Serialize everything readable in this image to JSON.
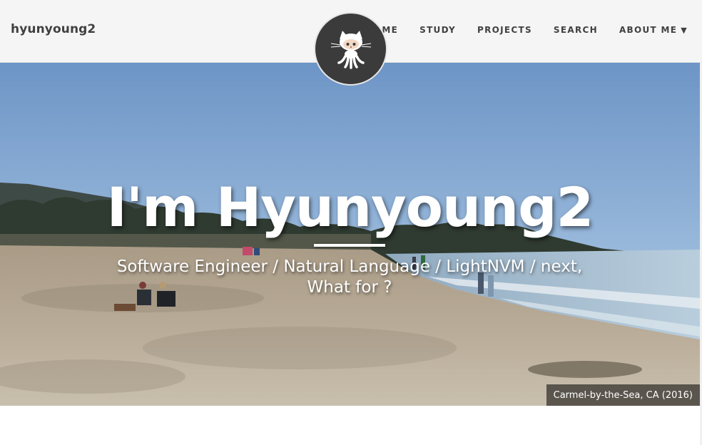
{
  "navbar": {
    "brand": "hyunyoung2",
    "items": [
      {
        "label": "HOME"
      },
      {
        "label": "STUDY"
      },
      {
        "label": "PROJECTS"
      },
      {
        "label": "SEARCH"
      },
      {
        "label": "ABOUT ME",
        "dropdown": true
      }
    ],
    "avatar_icon": "github-octocat-icon"
  },
  "hero": {
    "title": "I'm Hyunyoung2",
    "subtitle_line1": "Software Engineer / Natural Language / LightNVM / next,",
    "subtitle_line2": "What for ?",
    "caption": "Carmel-by-the-Sea, CA (2016)"
  },
  "colors": {
    "navbar_bg": "#f5f5f5",
    "nav_text": "#404040",
    "avatar_bg": "#3b3b3b",
    "sky": "#8fb2d9",
    "sand": "#b9ab95",
    "sea": "#a9c3d6"
  }
}
